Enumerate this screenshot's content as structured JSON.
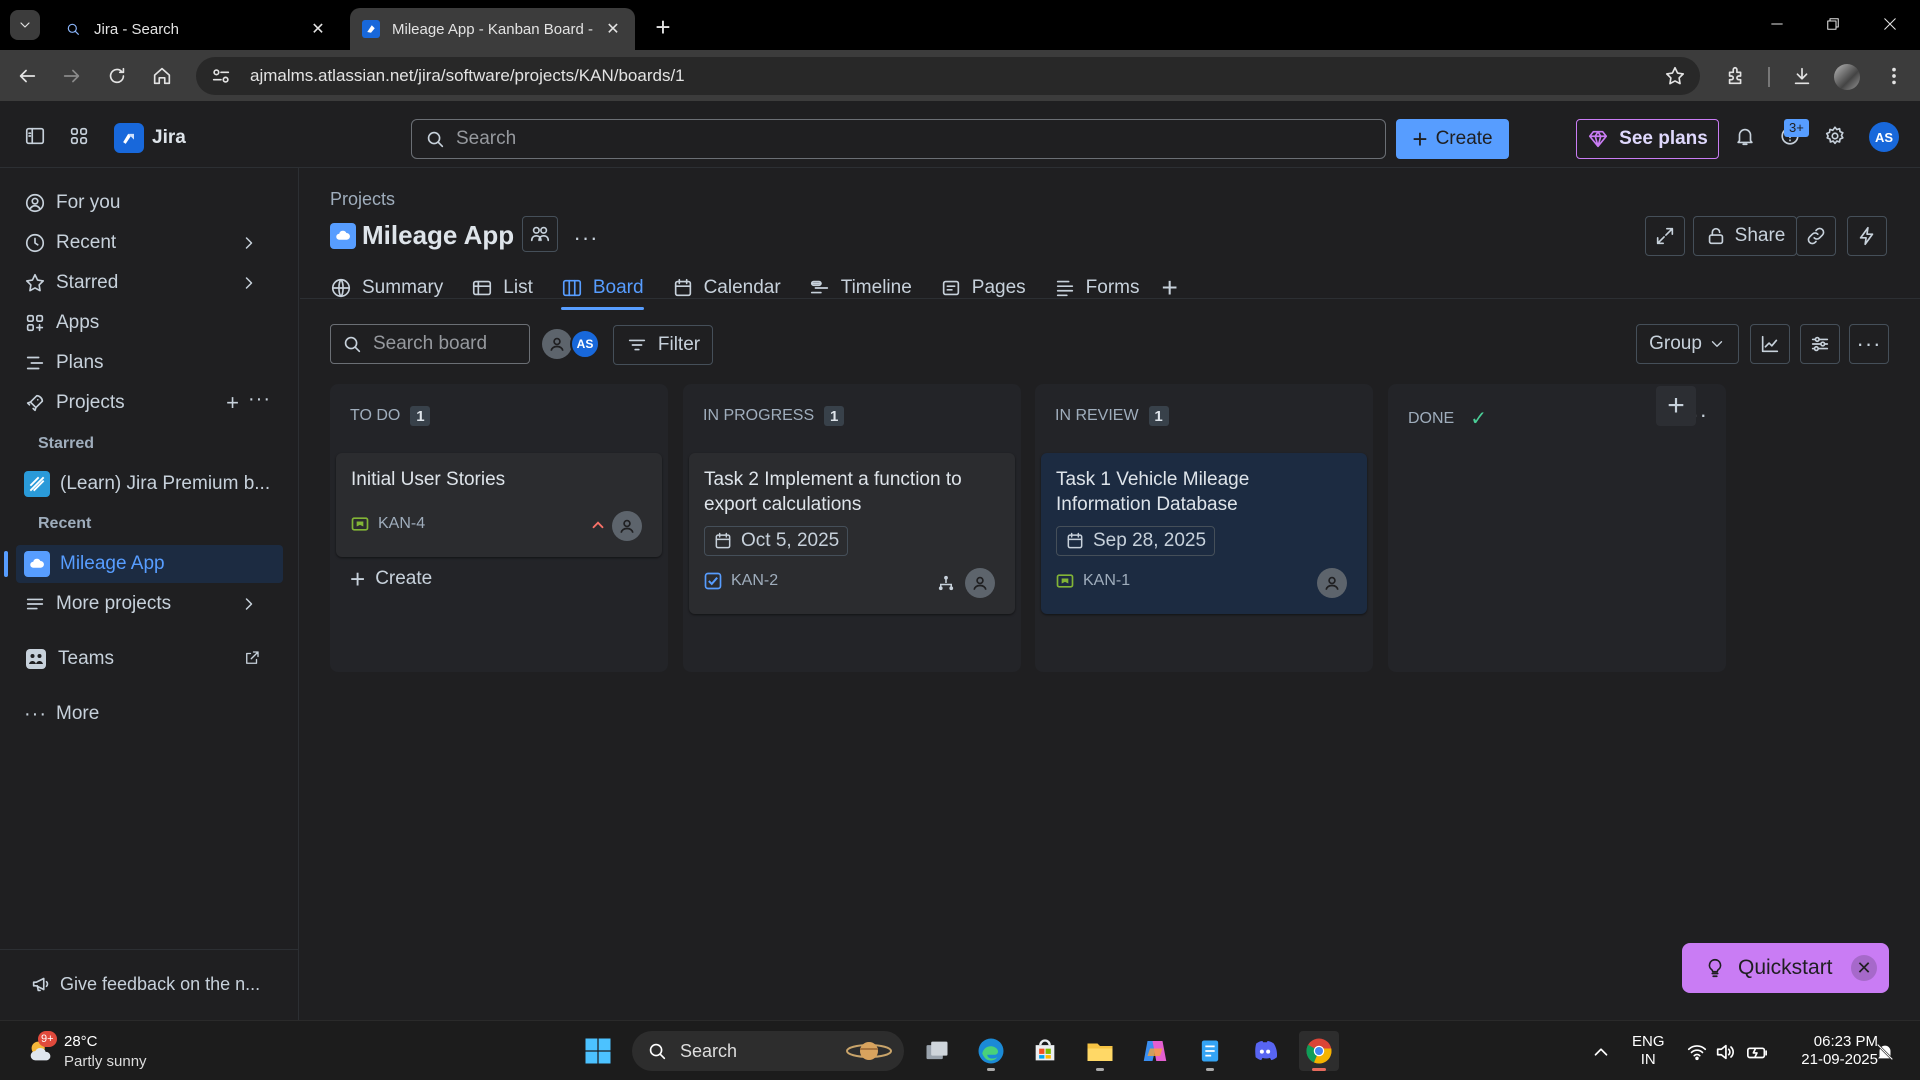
{
  "browser": {
    "tabs": [
      {
        "title": "Jira - Search",
        "active": false
      },
      {
        "title": "Mileage App - Kanban Board - ",
        "active": true
      }
    ],
    "url": "ajmalms.atlassian.net/jira/software/projects/KAN/boards/1"
  },
  "topnav": {
    "app_name": "Jira",
    "search_placeholder": "Search",
    "create_label": "Create",
    "see_plans_label": "See plans",
    "help_badge": "3+",
    "user_initials": "AS"
  },
  "sidebar": {
    "items": [
      {
        "label": "For you"
      },
      {
        "label": "Recent"
      },
      {
        "label": "Starred"
      },
      {
        "label": "Apps"
      },
      {
        "label": "Plans"
      },
      {
        "label": "Projects"
      }
    ],
    "starred_heading": "Starred",
    "starred_project": "(Learn) Jira Premium b...",
    "recent_heading": "Recent",
    "recent_project": "Mileage App",
    "more_projects": "More projects",
    "teams": "Teams",
    "more": "More",
    "feedback": "Give feedback on the n..."
  },
  "project": {
    "breadcrumb": "Projects",
    "title": "Mileage App",
    "share_label": "Share",
    "tabs": [
      {
        "label": "Summary",
        "icon": "globe-icon"
      },
      {
        "label": "List",
        "icon": "list-icon"
      },
      {
        "label": "Board",
        "icon": "board-icon",
        "active": true
      },
      {
        "label": "Calendar",
        "icon": "calendar-icon"
      },
      {
        "label": "Timeline",
        "icon": "timeline-icon"
      },
      {
        "label": "Pages",
        "icon": "pages-icon"
      },
      {
        "label": "Forms",
        "icon": "forms-icon"
      }
    ]
  },
  "board": {
    "search_placeholder": "Search board",
    "filter_label": "Filter",
    "group_label": "Group",
    "assignee_initials": "AS",
    "columns": [
      {
        "name": "TO DO",
        "count": "1",
        "create_label": "Create",
        "cards": [
          {
            "title": "Initial User Stories",
            "key": "KAN-4",
            "type": "story-icon",
            "priority": "high-priority-icon"
          }
        ]
      },
      {
        "name": "IN PROGRESS",
        "count": "1",
        "cards": [
          {
            "title": "Task 2 Implement a function to export calculations",
            "date": "Oct 5, 2025",
            "key": "KAN-2",
            "type": "task-icon"
          }
        ]
      },
      {
        "name": "IN REVIEW",
        "count": "1",
        "cards": [
          {
            "title": "Task 1 Vehicle Mileage Information Database",
            "date": "Sep 28, 2025",
            "key": "KAN-1",
            "type": "story-icon",
            "selected": true
          }
        ]
      },
      {
        "name": "DONE",
        "done_check": "✓",
        "cards": []
      }
    ]
  },
  "quickstart": {
    "label": "Quickstart"
  },
  "taskbar": {
    "weather_temp": "28°C",
    "weather_desc": "Partly sunny",
    "weather_badge": "9+",
    "search_label": "Search",
    "lang_top": "ENG",
    "lang_bottom": "IN",
    "time": "06:23 PM",
    "date": "21-09-2025"
  },
  "colors": {
    "accent": "#579dff",
    "purple": "#c97cf4",
    "background": "#1f1f21",
    "column": "#232428",
    "selected_card": "#1c2b41"
  }
}
